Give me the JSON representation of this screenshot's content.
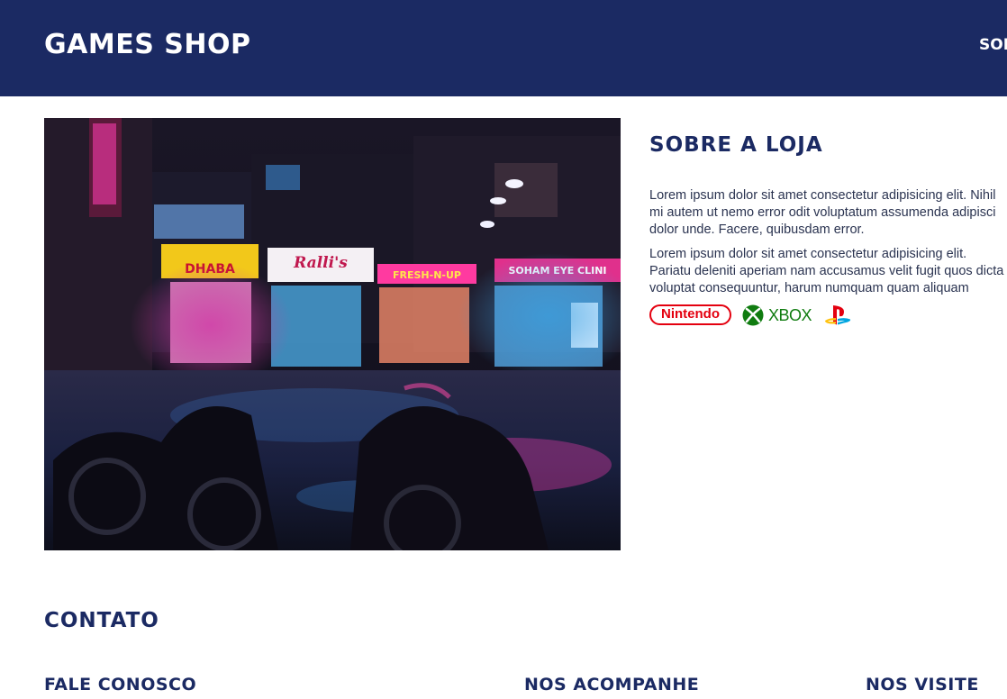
{
  "header": {
    "logo": "GAMES SHOP",
    "nav_item": "SOB"
  },
  "about": {
    "image_alt": "Night street with neon-lit shops",
    "title": "SOBRE A LOJA",
    "paragraph_1": "Lorem ipsum dolor sit amet consectetur adipisicing elit. Nihil mi autem ut nemo error odit voluptatum assumenda adipisci dolor unde. Facere, quibusdam error.",
    "paragraph_2": "Lorem ipsum dolor sit amet consectetur adipisicing elit. Pariatu deleniti aperiam nam accusamus velit fugit quos dicta voluptat consequuntur, harum numquam quam aliquam unde?",
    "brands": {
      "nintendo": "Nintendo",
      "xbox": "XBOX",
      "playstation_icon": "playstation-icon"
    }
  },
  "contact": {
    "title": "CONTATO",
    "columns": [
      "FALE CONOSCO",
      "NOS ACOMPANHE",
      "NOS VISITE"
    ]
  },
  "colors": {
    "brand_navy": "#1b2a63",
    "nintendo_red": "#e4000f",
    "xbox_green": "#107c10"
  }
}
